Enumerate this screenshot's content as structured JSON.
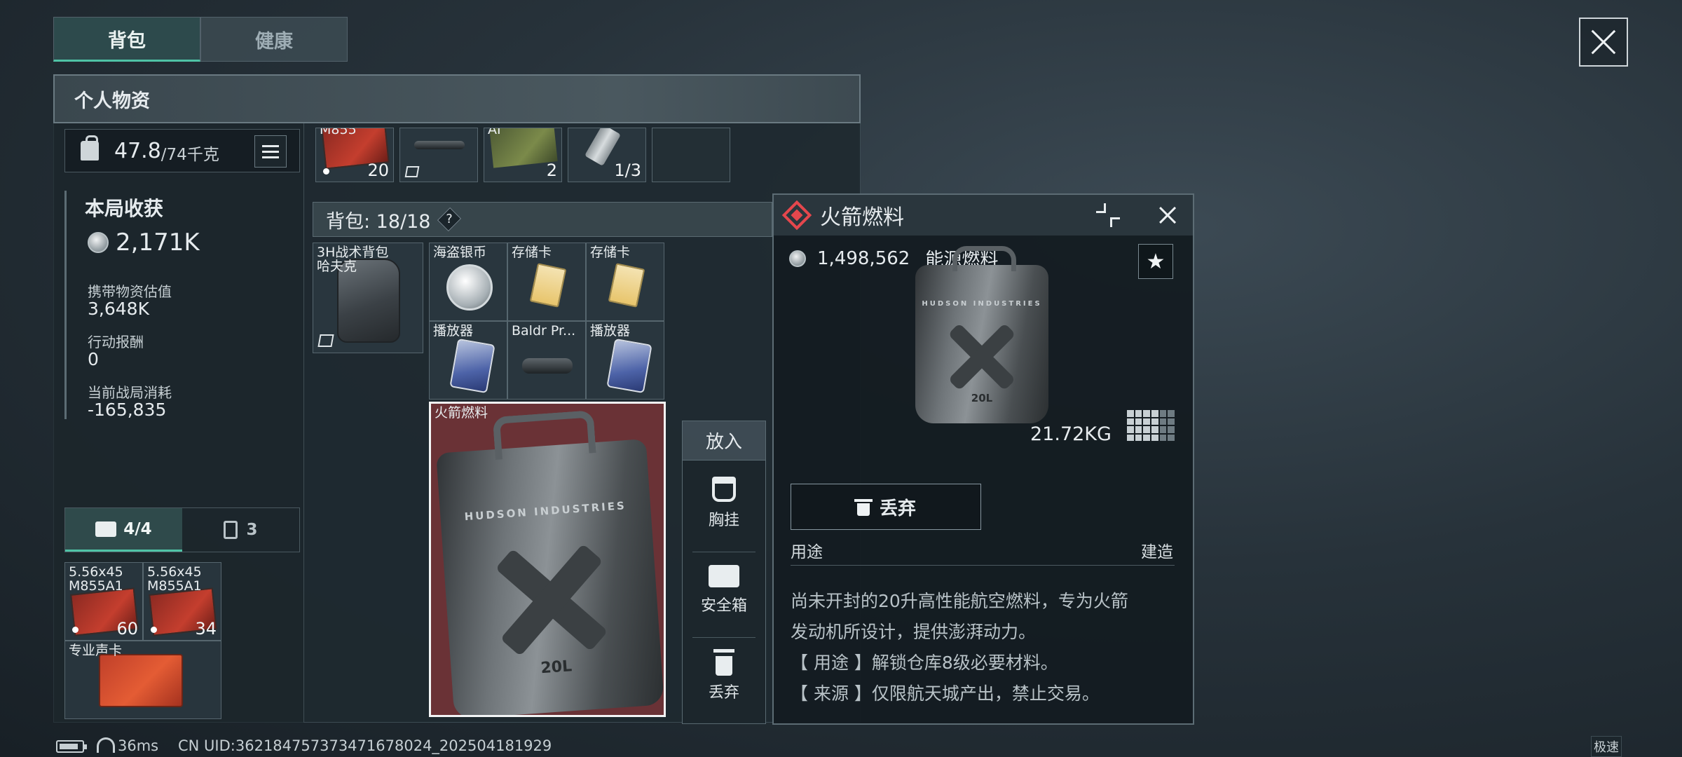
{
  "tabs": [
    {
      "label": "背包",
      "active": true
    },
    {
      "label": "健康",
      "active": false
    }
  ],
  "panel": {
    "title": "个人物资",
    "weight": {
      "current": "47.8",
      "max": "/74千克"
    },
    "earnings": {
      "title": "本局收获",
      "value": "2,171K",
      "stats": [
        {
          "label": "携带物资估值",
          "value": "3,648K"
        },
        {
          "label": "行动报酬",
          "value": "0"
        },
        {
          "label": "当前战局消耗",
          "value": "-165,835"
        }
      ]
    },
    "slot_tabs": [
      {
        "label": "4/4",
        "icon": "medkit-icon",
        "active": true
      },
      {
        "label": "3",
        "icon": "case-icon",
        "active": false
      }
    ],
    "pocket_items": [
      {
        "label": "5.56x45 M855A1",
        "count": "60"
      },
      {
        "label": "5.56x45 M855A1",
        "count": "34"
      },
      {
        "label": "专业声卡",
        "count": ""
      }
    ],
    "top_row_items": [
      {
        "label": "M855",
        "count": "20"
      },
      {
        "label": "",
        "count": ""
      },
      {
        "label": "AI",
        "count": "2"
      },
      {
        "label": "",
        "count": "1/3"
      },
      {
        "label": "",
        "count": ""
      }
    ]
  },
  "backpack": {
    "title": "背包: 18/18",
    "help": "?",
    "bag_item": {
      "label": "3H战术背包 哈夫克"
    },
    "items": [
      {
        "label": "海盗银币"
      },
      {
        "label": "存储卡"
      },
      {
        "label": "存储卡"
      },
      {
        "label": "播放器"
      },
      {
        "label": "Baldr Pr..."
      },
      {
        "label": "播放器"
      }
    ],
    "fuel_item": {
      "label": "火箭燃料",
      "brand": "HUDSON INDUSTRIES",
      "volume": "20L"
    }
  },
  "actions": {
    "header": "放入",
    "items": [
      {
        "label": "胸挂",
        "icon": "chest-rig-icon"
      },
      {
        "label": "安全箱",
        "icon": "safe-box-icon"
      },
      {
        "label": "丢弃",
        "icon": "trash-icon"
      }
    ]
  },
  "detail": {
    "title": "火箭燃料",
    "price": "1,498,562",
    "category": "能源燃料",
    "weight": "21.72KG",
    "discard_label": "丢弃",
    "usage_label": "用途",
    "build_label": "建造",
    "description": [
      "尚未开封的20升高性能航空燃料，专为火箭",
      "发动机所设计，提供澎湃动力。",
      "【 用途 】解锁仓库8级必要材料。",
      "【 来源 】仅限航天城产出，禁止交易。"
    ],
    "rarity_color": "#e5474d"
  },
  "status_bar": {
    "ping": "36ms",
    "uid": "CN UID:362184757373471678024_202504181929",
    "mode": "极速"
  }
}
